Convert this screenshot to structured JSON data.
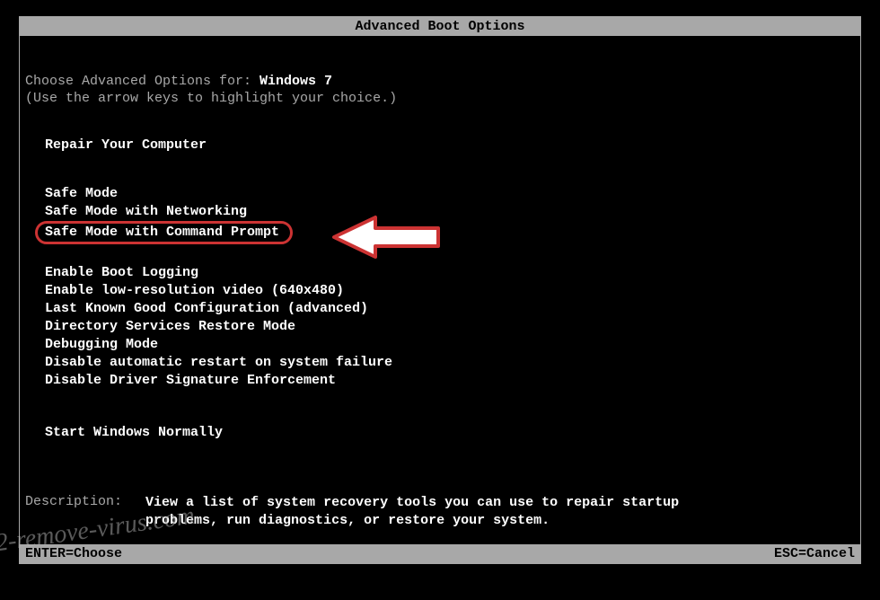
{
  "title": "Advanced Boot Options",
  "prompt_prefix": "Choose Advanced Options for: ",
  "os_name": "Windows 7",
  "hint": "(Use the arrow keys to highlight your choice.)",
  "group1": [
    "Repair Your Computer"
  ],
  "group2": [
    "Safe Mode",
    "Safe Mode with Networking",
    "Safe Mode with Command Prompt"
  ],
  "group3": [
    "Enable Boot Logging",
    "Enable low-resolution video (640x480)",
    "Last Known Good Configuration (advanced)",
    "Directory Services Restore Mode",
    "Debugging Mode",
    "Disable automatic restart on system failure",
    "Disable Driver Signature Enforcement"
  ],
  "group4": [
    "Start Windows Normally"
  ],
  "highlighted_index": 2,
  "description_label": "Description:",
  "description_text": "View a list of system recovery tools you can use to repair startup problems, run diagnostics, or restore your system.",
  "footer_left": "ENTER=Choose",
  "footer_right": "ESC=Cancel",
  "watermark": "2-remove-virus.com"
}
